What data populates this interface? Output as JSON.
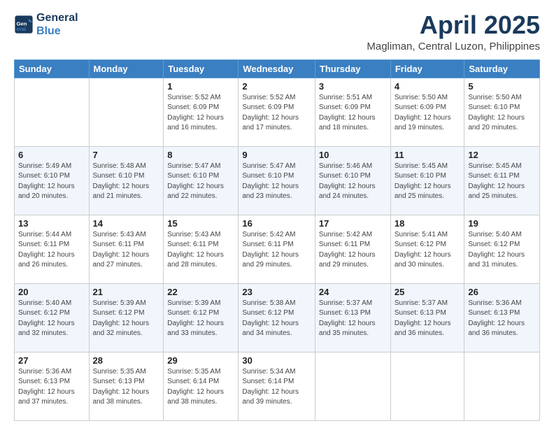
{
  "logo": {
    "line1": "General",
    "line2": "Blue"
  },
  "title": "April 2025",
  "subtitle": "Magliman, Central Luzon, Philippines",
  "weekdays": [
    "Sunday",
    "Monday",
    "Tuesday",
    "Wednesday",
    "Thursday",
    "Friday",
    "Saturday"
  ],
  "weeks": [
    [
      {
        "day": "",
        "sunrise": "",
        "sunset": "",
        "daylight": ""
      },
      {
        "day": "",
        "sunrise": "",
        "sunset": "",
        "daylight": ""
      },
      {
        "day": "1",
        "sunrise": "Sunrise: 5:52 AM",
        "sunset": "Sunset: 6:09 PM",
        "daylight": "Daylight: 12 hours and 16 minutes."
      },
      {
        "day": "2",
        "sunrise": "Sunrise: 5:52 AM",
        "sunset": "Sunset: 6:09 PM",
        "daylight": "Daylight: 12 hours and 17 minutes."
      },
      {
        "day": "3",
        "sunrise": "Sunrise: 5:51 AM",
        "sunset": "Sunset: 6:09 PM",
        "daylight": "Daylight: 12 hours and 18 minutes."
      },
      {
        "day": "4",
        "sunrise": "Sunrise: 5:50 AM",
        "sunset": "Sunset: 6:09 PM",
        "daylight": "Daylight: 12 hours and 19 minutes."
      },
      {
        "day": "5",
        "sunrise": "Sunrise: 5:50 AM",
        "sunset": "Sunset: 6:10 PM",
        "daylight": "Daylight: 12 hours and 20 minutes."
      }
    ],
    [
      {
        "day": "6",
        "sunrise": "Sunrise: 5:49 AM",
        "sunset": "Sunset: 6:10 PM",
        "daylight": "Daylight: 12 hours and 20 minutes."
      },
      {
        "day": "7",
        "sunrise": "Sunrise: 5:48 AM",
        "sunset": "Sunset: 6:10 PM",
        "daylight": "Daylight: 12 hours and 21 minutes."
      },
      {
        "day": "8",
        "sunrise": "Sunrise: 5:47 AM",
        "sunset": "Sunset: 6:10 PM",
        "daylight": "Daylight: 12 hours and 22 minutes."
      },
      {
        "day": "9",
        "sunrise": "Sunrise: 5:47 AM",
        "sunset": "Sunset: 6:10 PM",
        "daylight": "Daylight: 12 hours and 23 minutes."
      },
      {
        "day": "10",
        "sunrise": "Sunrise: 5:46 AM",
        "sunset": "Sunset: 6:10 PM",
        "daylight": "Daylight: 12 hours and 24 minutes."
      },
      {
        "day": "11",
        "sunrise": "Sunrise: 5:45 AM",
        "sunset": "Sunset: 6:10 PM",
        "daylight": "Daylight: 12 hours and 25 minutes."
      },
      {
        "day": "12",
        "sunrise": "Sunrise: 5:45 AM",
        "sunset": "Sunset: 6:11 PM",
        "daylight": "Daylight: 12 hours and 25 minutes."
      }
    ],
    [
      {
        "day": "13",
        "sunrise": "Sunrise: 5:44 AM",
        "sunset": "Sunset: 6:11 PM",
        "daylight": "Daylight: 12 hours and 26 minutes."
      },
      {
        "day": "14",
        "sunrise": "Sunrise: 5:43 AM",
        "sunset": "Sunset: 6:11 PM",
        "daylight": "Daylight: 12 hours and 27 minutes."
      },
      {
        "day": "15",
        "sunrise": "Sunrise: 5:43 AM",
        "sunset": "Sunset: 6:11 PM",
        "daylight": "Daylight: 12 hours and 28 minutes."
      },
      {
        "day": "16",
        "sunrise": "Sunrise: 5:42 AM",
        "sunset": "Sunset: 6:11 PM",
        "daylight": "Daylight: 12 hours and 29 minutes."
      },
      {
        "day": "17",
        "sunrise": "Sunrise: 5:42 AM",
        "sunset": "Sunset: 6:11 PM",
        "daylight": "Daylight: 12 hours and 29 minutes."
      },
      {
        "day": "18",
        "sunrise": "Sunrise: 5:41 AM",
        "sunset": "Sunset: 6:12 PM",
        "daylight": "Daylight: 12 hours and 30 minutes."
      },
      {
        "day": "19",
        "sunrise": "Sunrise: 5:40 AM",
        "sunset": "Sunset: 6:12 PM",
        "daylight": "Daylight: 12 hours and 31 minutes."
      }
    ],
    [
      {
        "day": "20",
        "sunrise": "Sunrise: 5:40 AM",
        "sunset": "Sunset: 6:12 PM",
        "daylight": "Daylight: 12 hours and 32 minutes."
      },
      {
        "day": "21",
        "sunrise": "Sunrise: 5:39 AM",
        "sunset": "Sunset: 6:12 PM",
        "daylight": "Daylight: 12 hours and 32 minutes."
      },
      {
        "day": "22",
        "sunrise": "Sunrise: 5:39 AM",
        "sunset": "Sunset: 6:12 PM",
        "daylight": "Daylight: 12 hours and 33 minutes."
      },
      {
        "day": "23",
        "sunrise": "Sunrise: 5:38 AM",
        "sunset": "Sunset: 6:12 PM",
        "daylight": "Daylight: 12 hours and 34 minutes."
      },
      {
        "day": "24",
        "sunrise": "Sunrise: 5:37 AM",
        "sunset": "Sunset: 6:13 PM",
        "daylight": "Daylight: 12 hours and 35 minutes."
      },
      {
        "day": "25",
        "sunrise": "Sunrise: 5:37 AM",
        "sunset": "Sunset: 6:13 PM",
        "daylight": "Daylight: 12 hours and 36 minutes."
      },
      {
        "day": "26",
        "sunrise": "Sunrise: 5:36 AM",
        "sunset": "Sunset: 6:13 PM",
        "daylight": "Daylight: 12 hours and 36 minutes."
      }
    ],
    [
      {
        "day": "27",
        "sunrise": "Sunrise: 5:36 AM",
        "sunset": "Sunset: 6:13 PM",
        "daylight": "Daylight: 12 hours and 37 minutes."
      },
      {
        "day": "28",
        "sunrise": "Sunrise: 5:35 AM",
        "sunset": "Sunset: 6:13 PM",
        "daylight": "Daylight: 12 hours and 38 minutes."
      },
      {
        "day": "29",
        "sunrise": "Sunrise: 5:35 AM",
        "sunset": "Sunset: 6:14 PM",
        "daylight": "Daylight: 12 hours and 38 minutes."
      },
      {
        "day": "30",
        "sunrise": "Sunrise: 5:34 AM",
        "sunset": "Sunset: 6:14 PM",
        "daylight": "Daylight: 12 hours and 39 minutes."
      },
      {
        "day": "",
        "sunrise": "",
        "sunset": "",
        "daylight": ""
      },
      {
        "day": "",
        "sunrise": "",
        "sunset": "",
        "daylight": ""
      },
      {
        "day": "",
        "sunrise": "",
        "sunset": "",
        "daylight": ""
      }
    ]
  ]
}
